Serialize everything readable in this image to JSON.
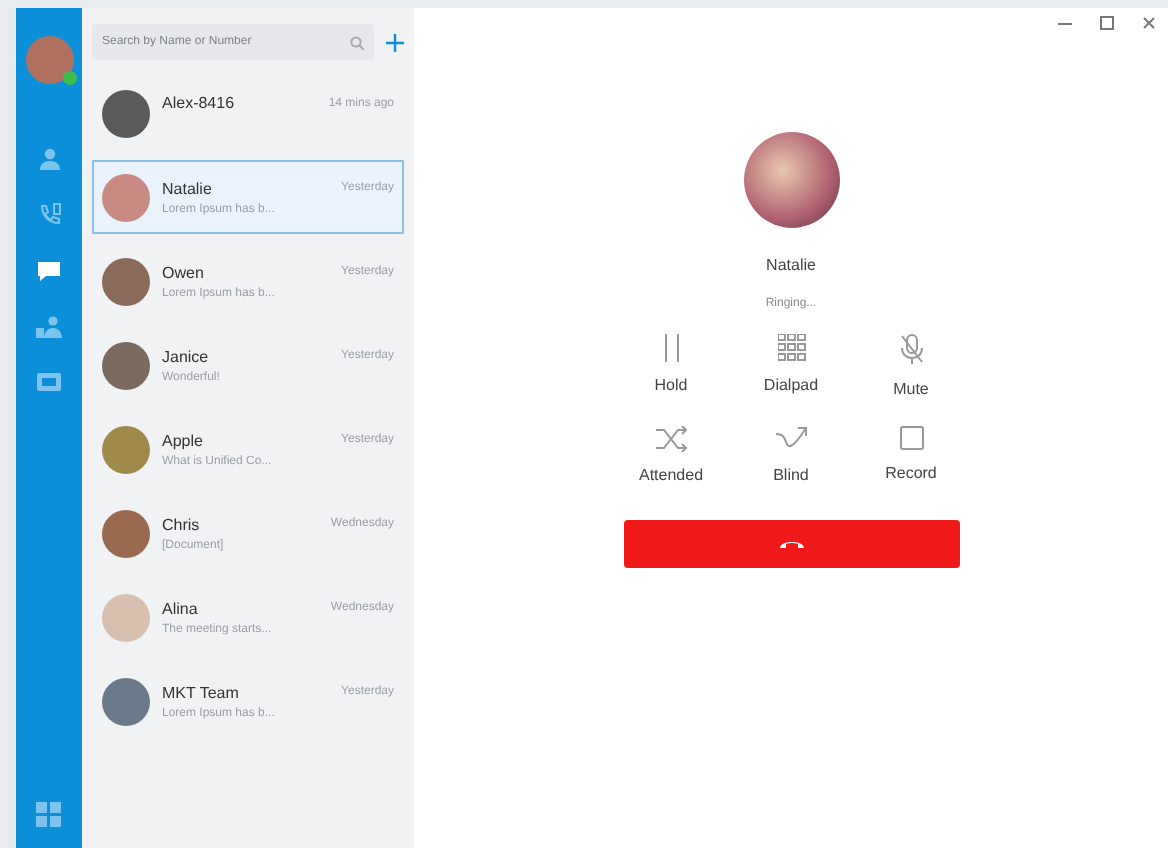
{
  "nav": {
    "items": [
      {
        "kind": "contact",
        "selected": false
      },
      {
        "kind": "calls",
        "selected": false
      },
      {
        "kind": "chat",
        "selected": true
      },
      {
        "kind": "group",
        "selected": false
      },
      {
        "kind": "card",
        "selected": false
      }
    ]
  },
  "search": {
    "placeholder": "Search by Name or Number"
  },
  "conversations": [
    {
      "name": "Alex-8416",
      "time": "14 mins ago",
      "selected": false,
      "color": "#5a5a5a"
    },
    {
      "name": "Natalie",
      "time": "Yesterday",
      "preview": "Lorem Ipsum has b...",
      "selected": true,
      "color": "#c98a84"
    },
    {
      "name": "Owen",
      "time": "Yesterday",
      "preview": "Lorem Ipsum has b...",
      "selected": false,
      "color": "#8a6a5a"
    },
    {
      "name": "Janice",
      "time": "Yesterday",
      "preview": "Wonderful!",
      "selected": false,
      "color": "#7a6a60"
    },
    {
      "name": "Apple",
      "time": "Yesterday",
      "preview": "What is Unified Co...",
      "selected": false,
      "color": "#a08a4a"
    },
    {
      "name": "Chris",
      "time": "Wednesday",
      "preview": "[Document]",
      "selected": false,
      "color": "#9a6a50"
    },
    {
      "name": "Alina",
      "time": "Wednesday",
      "preview": "The meeting starts...",
      "selected": false,
      "color": "#d8c0b0"
    },
    {
      "name": "MKT Team",
      "time": "Yesterday",
      "preview": "Lorem Ipsum has b...",
      "selected": false,
      "color": "#6a7a8a"
    }
  ],
  "call": {
    "name": "Natalie",
    "status": "Ringing...",
    "actions": [
      {
        "kind": "hold",
        "label": "Hold"
      },
      {
        "kind": "dialpad",
        "label": "Dialpad"
      },
      {
        "kind": "mute",
        "label": "Mute"
      },
      {
        "kind": "attended",
        "label": "Attended"
      },
      {
        "kind": "blind",
        "label": "Blind"
      },
      {
        "kind": "record",
        "label": "Record"
      }
    ]
  }
}
